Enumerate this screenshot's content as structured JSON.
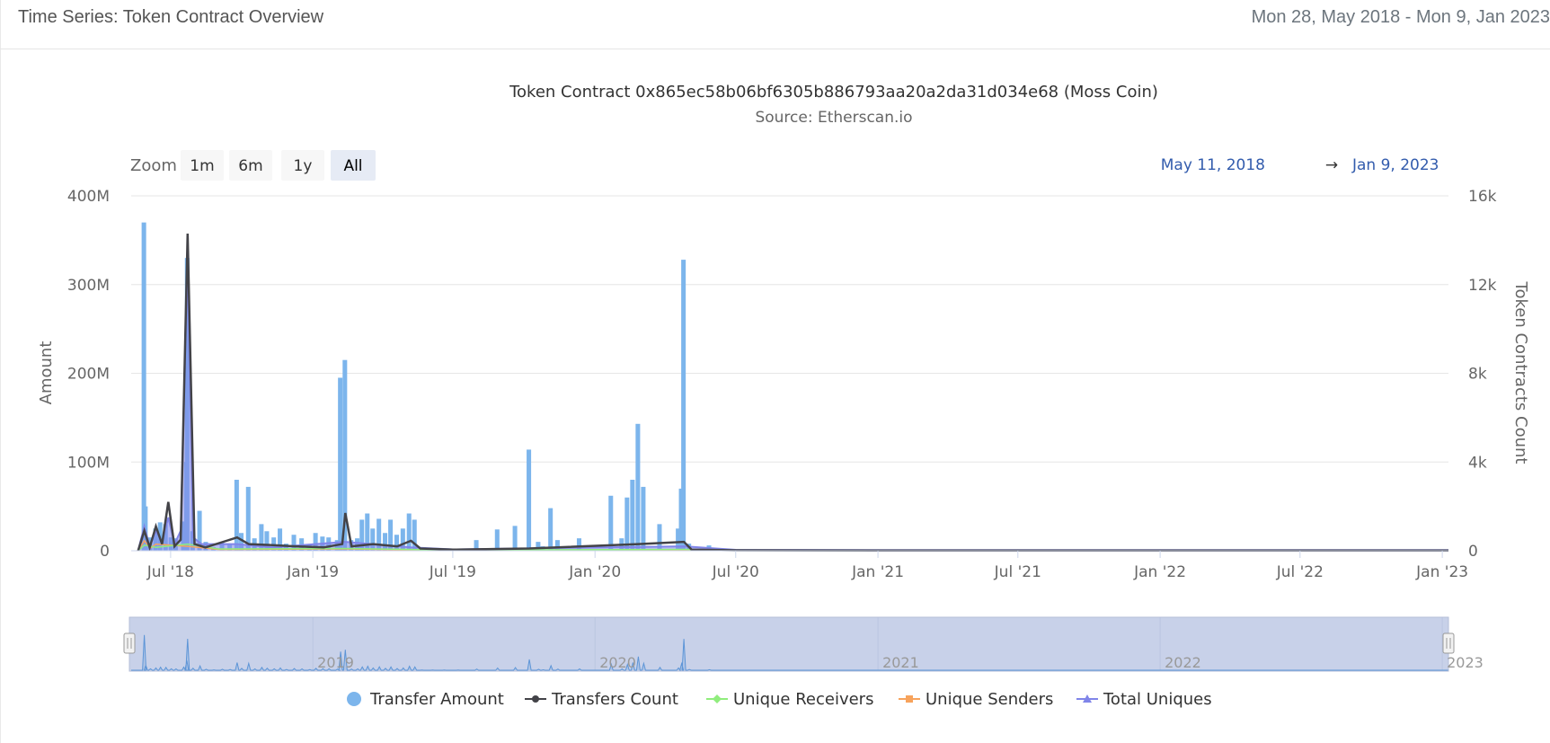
{
  "header": {
    "title": "Time Series: Token Contract Overview",
    "date_range": "Mon 28, May 2018 - Mon 9, Jan 2023"
  },
  "chart_data": {
    "type": "bar",
    "title": "Token Contract 0x865ec58b06bf6305b886793aa20a2da31d034e68 (Moss Coin)",
    "subtitle": "Source: Etherscan.io",
    "zoom": {
      "label": "Zoom",
      "buttons": [
        "1m",
        "6m",
        "1y",
        "All"
      ],
      "selected": "All"
    },
    "range_display": {
      "from": "May 11, 2018",
      "arrow": "→",
      "to": "Jan 9, 2023"
    },
    "ylabel": "Amount",
    "y2label": "Token Contracts Count",
    "ylim": [
      0,
      400000000
    ],
    "y2lim": [
      0,
      16000
    ],
    "yticks": [
      "0",
      "100M",
      "200M",
      "300M",
      "400M"
    ],
    "y2ticks": [
      "0",
      "4k",
      "8k",
      "12k",
      "16k"
    ],
    "xlim": [
      "2018-05-11",
      "2023-01-09"
    ],
    "xticks": [
      {
        "date": "2018-07-01",
        "label": "Jul '18"
      },
      {
        "date": "2019-01-01",
        "label": "Jan '19"
      },
      {
        "date": "2019-07-01",
        "label": "Jul '19"
      },
      {
        "date": "2020-01-01",
        "label": "Jan '20"
      },
      {
        "date": "2020-07-01",
        "label": "Jul '20"
      },
      {
        "date": "2021-01-01",
        "label": "Jan '21"
      },
      {
        "date": "2021-07-01",
        "label": "Jul '21"
      },
      {
        "date": "2022-01-01",
        "label": "Jan '22"
      },
      {
        "date": "2022-07-01",
        "label": "Jul '22"
      },
      {
        "date": "2023-01-01",
        "label": "Jan '23"
      }
    ],
    "navigator_labels": [
      {
        "date": "2019-01-01",
        "label": "2019"
      },
      {
        "date": "2020-01-01",
        "label": "2020"
      },
      {
        "date": "2021-01-01",
        "label": "2021"
      },
      {
        "date": "2022-01-01",
        "label": "2022"
      },
      {
        "date": "2023-01-01",
        "label": "2023"
      }
    ],
    "legend_position": "bottom-center",
    "series": [
      {
        "name": "Transfer Amount",
        "type": "bar",
        "axis": "left",
        "color": "#7cb5ec",
        "points": [
          [
            "2018-05-28",
            370000000
          ],
          [
            "2018-05-30",
            50000000
          ],
          [
            "2018-06-05",
            15000000
          ],
          [
            "2018-06-12",
            25000000
          ],
          [
            "2018-06-18",
            32000000
          ],
          [
            "2018-06-25",
            30000000
          ],
          [
            "2018-07-02",
            15000000
          ],
          [
            "2018-07-08",
            14000000
          ],
          [
            "2018-07-18",
            33000000
          ],
          [
            "2018-07-22",
            100000000
          ],
          [
            "2018-07-23",
            330000000
          ],
          [
            "2018-07-30",
            22000000
          ],
          [
            "2018-08-08",
            45000000
          ],
          [
            "2018-08-16",
            10000000
          ],
          [
            "2018-08-26",
            4000000
          ],
          [
            "2018-09-06",
            10000000
          ],
          [
            "2018-09-16",
            8000000
          ],
          [
            "2018-09-25",
            80000000
          ],
          [
            "2018-10-01",
            20000000
          ],
          [
            "2018-10-10",
            72000000
          ],
          [
            "2018-10-18",
            14000000
          ],
          [
            "2018-10-27",
            30000000
          ],
          [
            "2018-11-03",
            22000000
          ],
          [
            "2018-11-12",
            15000000
          ],
          [
            "2018-11-20",
            25000000
          ],
          [
            "2018-11-28",
            8000000
          ],
          [
            "2018-12-08",
            18000000
          ],
          [
            "2018-12-18",
            14000000
          ],
          [
            "2018-12-28",
            7000000
          ],
          [
            "2019-01-05",
            20000000
          ],
          [
            "2019-01-14",
            16000000
          ],
          [
            "2019-01-22",
            15000000
          ],
          [
            "2019-02-02",
            12000000
          ],
          [
            "2019-02-06",
            195000000
          ],
          [
            "2019-02-12",
            215000000
          ],
          [
            "2019-02-20",
            12000000
          ],
          [
            "2019-02-28",
            14000000
          ],
          [
            "2019-03-06",
            35000000
          ],
          [
            "2019-03-13",
            42000000
          ],
          [
            "2019-03-20",
            25000000
          ],
          [
            "2019-03-28",
            36000000
          ],
          [
            "2019-04-05",
            20000000
          ],
          [
            "2019-04-12",
            35000000
          ],
          [
            "2019-04-20",
            18000000
          ],
          [
            "2019-04-28",
            25000000
          ],
          [
            "2019-05-06",
            42000000
          ],
          [
            "2019-05-13",
            35000000
          ],
          [
            "2019-05-22",
            3000000
          ],
          [
            "2019-06-05",
            2000000
          ],
          [
            "2019-06-20",
            2000000
          ],
          [
            "2019-07-08",
            2000000
          ],
          [
            "2019-08-01",
            12000000
          ],
          [
            "2019-08-28",
            24000000
          ],
          [
            "2019-09-20",
            28000000
          ],
          [
            "2019-10-08",
            114000000
          ],
          [
            "2019-10-20",
            10000000
          ],
          [
            "2019-10-26",
            5000000
          ],
          [
            "2019-11-05",
            48000000
          ],
          [
            "2019-11-14",
            12000000
          ],
          [
            "2019-12-12",
            14000000
          ],
          [
            "2020-01-22",
            62000000
          ],
          [
            "2020-02-05",
            14000000
          ],
          [
            "2020-02-12",
            60000000
          ],
          [
            "2020-02-19",
            80000000
          ],
          [
            "2020-02-26",
            143000000
          ],
          [
            "2020-03-04",
            72000000
          ],
          [
            "2020-03-25",
            30000000
          ],
          [
            "2020-04-18",
            25000000
          ],
          [
            "2020-04-22",
            70000000
          ],
          [
            "2020-04-25",
            328000000
          ],
          [
            "2020-05-02",
            8000000
          ],
          [
            "2020-05-28",
            6000000
          ]
        ]
      },
      {
        "name": "Transfers Count",
        "type": "line",
        "axis": "right",
        "color": "#434348",
        "points": [
          [
            "2018-05-20",
            0
          ],
          [
            "2018-05-28",
            900
          ],
          [
            "2018-06-04",
            150
          ],
          [
            "2018-06-12",
            1100
          ],
          [
            "2018-06-20",
            300
          ],
          [
            "2018-06-28",
            2200
          ],
          [
            "2018-07-06",
            200
          ],
          [
            "2018-07-14",
            500
          ],
          [
            "2018-07-23",
            14300
          ],
          [
            "2018-08-01",
            300
          ],
          [
            "2018-08-15",
            150
          ],
          [
            "2018-09-25",
            600
          ],
          [
            "2018-10-10",
            300
          ],
          [
            "2018-11-10",
            250
          ],
          [
            "2018-12-10",
            200
          ],
          [
            "2019-01-15",
            150
          ],
          [
            "2019-02-08",
            300
          ],
          [
            "2019-02-12",
            1700
          ],
          [
            "2019-02-20",
            200
          ],
          [
            "2019-03-20",
            300
          ],
          [
            "2019-04-20",
            200
          ],
          [
            "2019-05-08",
            450
          ],
          [
            "2019-05-20",
            100
          ],
          [
            "2019-07-01",
            50
          ],
          [
            "2019-10-08",
            100
          ],
          [
            "2020-02-26",
            300
          ],
          [
            "2020-04-25",
            400
          ],
          [
            "2020-05-05",
            50
          ],
          [
            "2020-07-01",
            20
          ],
          [
            "2021-01-01",
            10
          ],
          [
            "2023-01-09",
            10
          ]
        ]
      },
      {
        "name": "Unique Receivers",
        "type": "line",
        "axis": "right",
        "color": "#90ed7d",
        "points": [
          [
            "2018-05-20",
            0
          ],
          [
            "2018-05-28",
            250
          ],
          [
            "2018-06-12",
            150
          ],
          [
            "2018-07-23",
            300
          ],
          [
            "2018-09-01",
            80
          ],
          [
            "2019-02-12",
            100
          ],
          [
            "2019-07-01",
            30
          ],
          [
            "2020-04-25",
            60
          ],
          [
            "2020-07-01",
            10
          ],
          [
            "2023-01-09",
            5
          ]
        ]
      },
      {
        "name": "Unique Senders",
        "type": "line",
        "axis": "right",
        "color": "#f7a35c",
        "points": [
          [
            "2018-05-20",
            0
          ],
          [
            "2018-05-28",
            450
          ],
          [
            "2018-06-05",
            120
          ],
          [
            "2018-06-12",
            300
          ],
          [
            "2018-07-23",
            200
          ],
          [
            "2018-09-01",
            60
          ],
          [
            "2019-02-12",
            80
          ],
          [
            "2019-07-01",
            20
          ],
          [
            "2020-04-25",
            40
          ],
          [
            "2020-07-01",
            10
          ],
          [
            "2023-01-09",
            5
          ]
        ]
      },
      {
        "name": "Total Uniques",
        "type": "area",
        "axis": "right",
        "color": "#8085e9",
        "points": [
          [
            "2018-05-20",
            0
          ],
          [
            "2018-05-28",
            1100
          ],
          [
            "2018-06-04",
            200
          ],
          [
            "2018-06-12",
            900
          ],
          [
            "2018-06-20",
            400
          ],
          [
            "2018-06-28",
            1500
          ],
          [
            "2018-07-06",
            300
          ],
          [
            "2018-07-14",
            900
          ],
          [
            "2018-07-23",
            13200
          ],
          [
            "2018-07-30",
            600
          ],
          [
            "2018-08-10",
            300
          ],
          [
            "2018-09-25",
            300
          ],
          [
            "2018-11-10",
            150
          ],
          [
            "2019-02-12",
            400
          ],
          [
            "2019-05-08",
            150
          ],
          [
            "2019-07-01",
            60
          ],
          [
            "2020-04-25",
            200
          ],
          [
            "2020-07-01",
            40
          ],
          [
            "2021-01-01",
            30
          ],
          [
            "2023-01-09",
            30
          ]
        ]
      }
    ]
  }
}
